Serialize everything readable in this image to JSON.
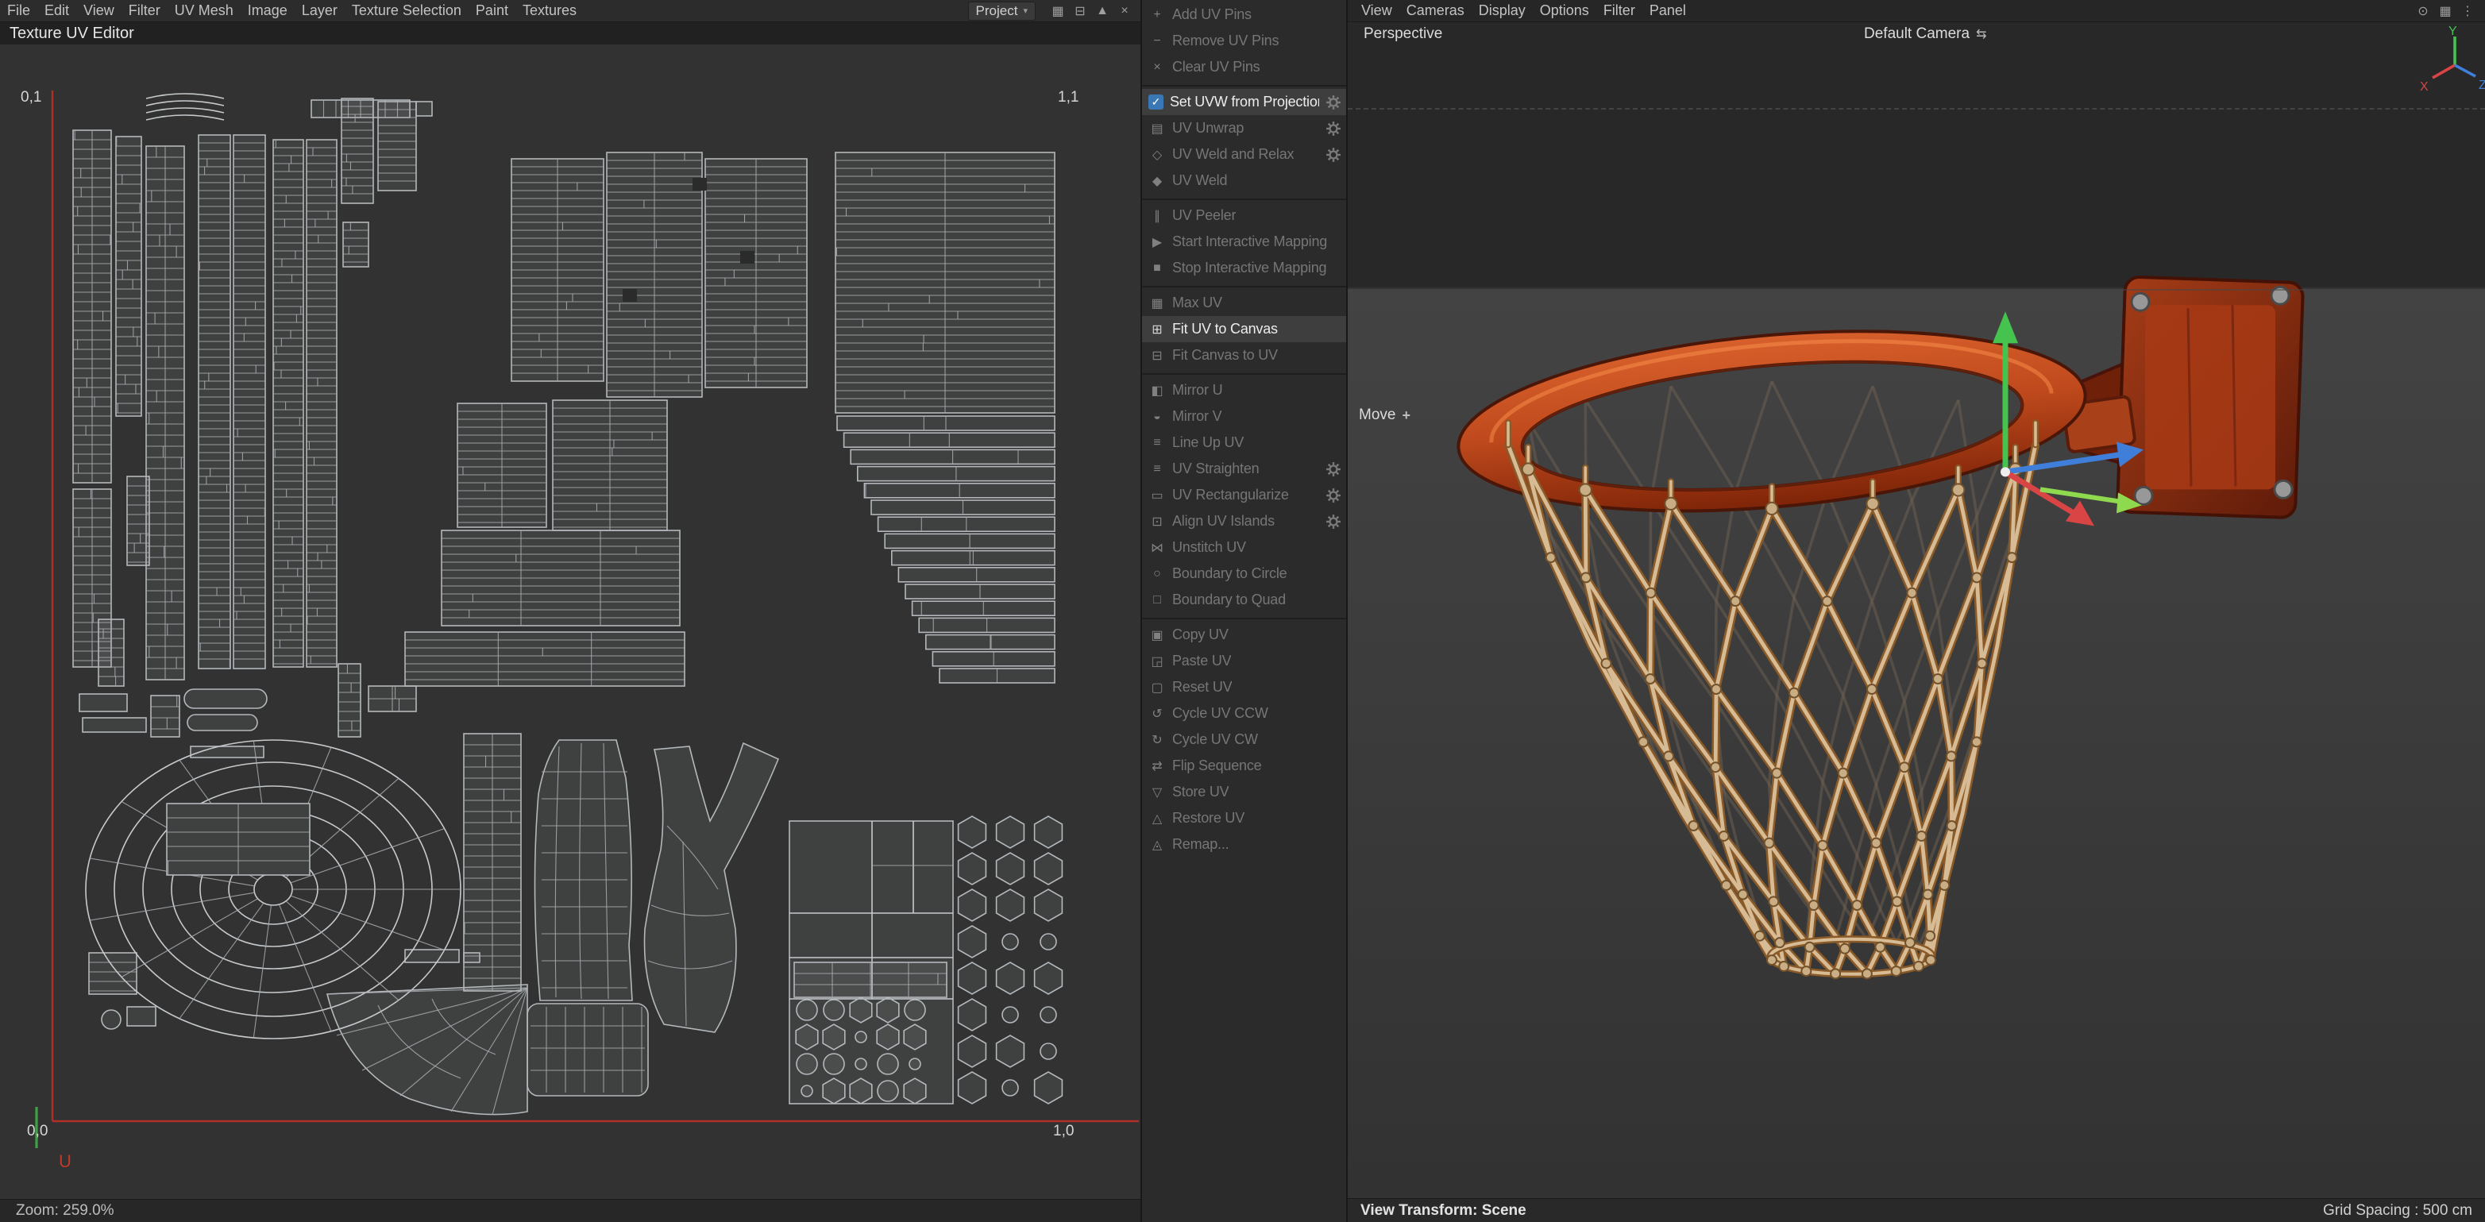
{
  "colors": {
    "rim_orange": "#c14a1e",
    "net_tan": "#d6bb94",
    "uv_boundary_red": "#b03028",
    "axis_x_red": "#d94444",
    "axis_y_green": "#46c24e",
    "axis_z_blue": "#3f7fd9",
    "enabled_row_bg": "#3e3e3e"
  },
  "left_menubar": {
    "items": [
      "File",
      "Edit",
      "View",
      "Filter",
      "UV Mesh",
      "Image",
      "Layer",
      "Texture Selection",
      "Paint",
      "Textures"
    ],
    "project_dropdown": "Project",
    "caret": "▾",
    "icons": [
      {
        "name": "layout-grid-icon",
        "glyph": "▦"
      },
      {
        "name": "dock-icon",
        "glyph": "⊟"
      },
      {
        "name": "maximize-icon",
        "glyph": "▲"
      },
      {
        "name": "close-icon",
        "glyph": "×"
      }
    ]
  },
  "uv_editor": {
    "title": "Texture UV Editor",
    "corners": {
      "top_left": "0,1",
      "top_right": "1,1",
      "bottom_left": "0,0",
      "bottom_right": "1,0"
    },
    "axis": {
      "u": "U"
    },
    "zoom_status": "Zoom: 259.0%"
  },
  "command_panel": {
    "items": [
      {
        "label": "Add UV Pins",
        "enabled": false,
        "gear": false,
        "sep_after": false,
        "icon": "pin-add",
        "glyph": "+"
      },
      {
        "label": "Remove UV Pins",
        "enabled": false,
        "gear": false,
        "sep_after": false,
        "icon": "pin-remove",
        "glyph": "−"
      },
      {
        "label": "Clear UV Pins",
        "enabled": false,
        "gear": false,
        "sep_after": true,
        "icon": "pin-clear",
        "glyph": "×"
      },
      {
        "label": "Set UVW from Projection",
        "enabled": true,
        "gear": true,
        "sep_after": false,
        "icon": "projection",
        "glyph": "✓"
      },
      {
        "label": "UV Unwrap",
        "enabled": false,
        "gear": true,
        "sep_after": false,
        "icon": "unwrap",
        "glyph": "▤"
      },
      {
        "label": "UV Weld and Relax",
        "enabled": false,
        "gear": true,
        "sep_after": false,
        "icon": "weld-relax",
        "glyph": "◇"
      },
      {
        "label": "UV Weld",
        "enabled": false,
        "gear": false,
        "sep_after": true,
        "icon": "weld",
        "glyph": "◆"
      },
      {
        "label": "UV Peeler",
        "enabled": false,
        "gear": false,
        "sep_after": false,
        "icon": "peeler",
        "glyph": "∥"
      },
      {
        "label": "Start Interactive Mapping",
        "enabled": false,
        "gear": false,
        "sep_after": false,
        "icon": "start-mapping",
        "glyph": "▶"
      },
      {
        "label": "Stop Interactive Mapping",
        "enabled": false,
        "gear": false,
        "sep_after": true,
        "icon": "stop-mapping",
        "glyph": "■"
      },
      {
        "label": "Max UV",
        "enabled": false,
        "gear": false,
        "sep_after": false,
        "icon": "max-uv",
        "glyph": "▦"
      },
      {
        "label": "Fit UV to Canvas",
        "enabled": true,
        "gear": false,
        "sep_after": false,
        "icon": "fit-uv",
        "glyph": "⊞"
      },
      {
        "label": "Fit Canvas to UV",
        "enabled": false,
        "gear": false,
        "sep_after": true,
        "icon": "fit-canvas",
        "glyph": "⊟"
      },
      {
        "label": "Mirror U",
        "enabled": false,
        "gear": false,
        "sep_after": false,
        "icon": "mirror-u",
        "glyph": "◧"
      },
      {
        "label": "Mirror V",
        "enabled": false,
        "gear": false,
        "sep_after": false,
        "icon": "mirror-v",
        "glyph": "◒"
      },
      {
        "label": "Line Up UV",
        "enabled": false,
        "gear": false,
        "sep_after": false,
        "icon": "lineup",
        "glyph": "≡"
      },
      {
        "label": "UV Straighten",
        "enabled": false,
        "gear": true,
        "sep_after": false,
        "icon": "straighten",
        "glyph": "≡"
      },
      {
        "label": "UV Rectangularize",
        "enabled": false,
        "gear": true,
        "sep_after": false,
        "icon": "rectangularize",
        "glyph": "▭"
      },
      {
        "label": "Align UV Islands",
        "enabled": false,
        "gear": true,
        "sep_after": false,
        "icon": "align-islands",
        "glyph": "⊡"
      },
      {
        "label": "Unstitch UV",
        "enabled": false,
        "gear": false,
        "sep_after": false,
        "icon": "unstitch",
        "glyph": "⋈"
      },
      {
        "label": "Boundary to Circle",
        "enabled": false,
        "gear": false,
        "sep_after": false,
        "icon": "boundary-circle",
        "glyph": "○"
      },
      {
        "label": "Boundary to Quad",
        "enabled": false,
        "gear": false,
        "sep_after": true,
        "icon": "boundary-quad",
        "glyph": "□"
      },
      {
        "label": "Copy UV",
        "enabled": false,
        "gear": false,
        "sep_after": false,
        "icon": "copy",
        "glyph": "▣"
      },
      {
        "label": "Paste UV",
        "enabled": false,
        "gear": false,
        "sep_after": false,
        "icon": "paste",
        "glyph": "◲"
      },
      {
        "label": "Reset UV",
        "enabled": false,
        "gear": false,
        "sep_after": false,
        "icon": "reset",
        "glyph": "▢"
      },
      {
        "label": "Cycle UV CCW",
        "enabled": false,
        "gear": false,
        "sep_after": false,
        "icon": "cycle-ccw",
        "glyph": "↺"
      },
      {
        "label": "Cycle UV CW",
        "enabled": false,
        "gear": false,
        "sep_after": false,
        "icon": "cycle-cw",
        "glyph": "↻"
      },
      {
        "label": "Flip Sequence",
        "enabled": false,
        "gear": false,
        "sep_after": false,
        "icon": "flip",
        "glyph": "⇄"
      },
      {
        "label": "Store UV",
        "enabled": false,
        "gear": false,
        "sep_after": false,
        "icon": "store",
        "glyph": "▽"
      },
      {
        "label": "Restore UV",
        "enabled": false,
        "gear": false,
        "sep_after": false,
        "icon": "restore",
        "glyph": "△"
      },
      {
        "label": "Remap...",
        "enabled": false,
        "gear": false,
        "sep_after": false,
        "icon": "remap",
        "glyph": "◬"
      }
    ]
  },
  "viewport": {
    "menu_items": [
      "View",
      "Cameras",
      "Display",
      "Options",
      "Filter",
      "Panel"
    ],
    "icons": [
      {
        "name": "camera-lock-icon",
        "glyph": "⊙"
      },
      {
        "name": "layout-grid-icon",
        "glyph": "▦"
      },
      {
        "name": "panel-menu-icon",
        "glyph": "⋮"
      }
    ],
    "view_label": "Perspective",
    "camera_label": "Default Camera",
    "camera_icon": "⇆",
    "tool_label": "Move",
    "move_icon": "+",
    "status_left": "View Transform: Scene",
    "status_right": "Grid Spacing : 500 cm",
    "axis_gizmo": {
      "x": "X",
      "y": "Y",
      "z": "Z"
    }
  }
}
